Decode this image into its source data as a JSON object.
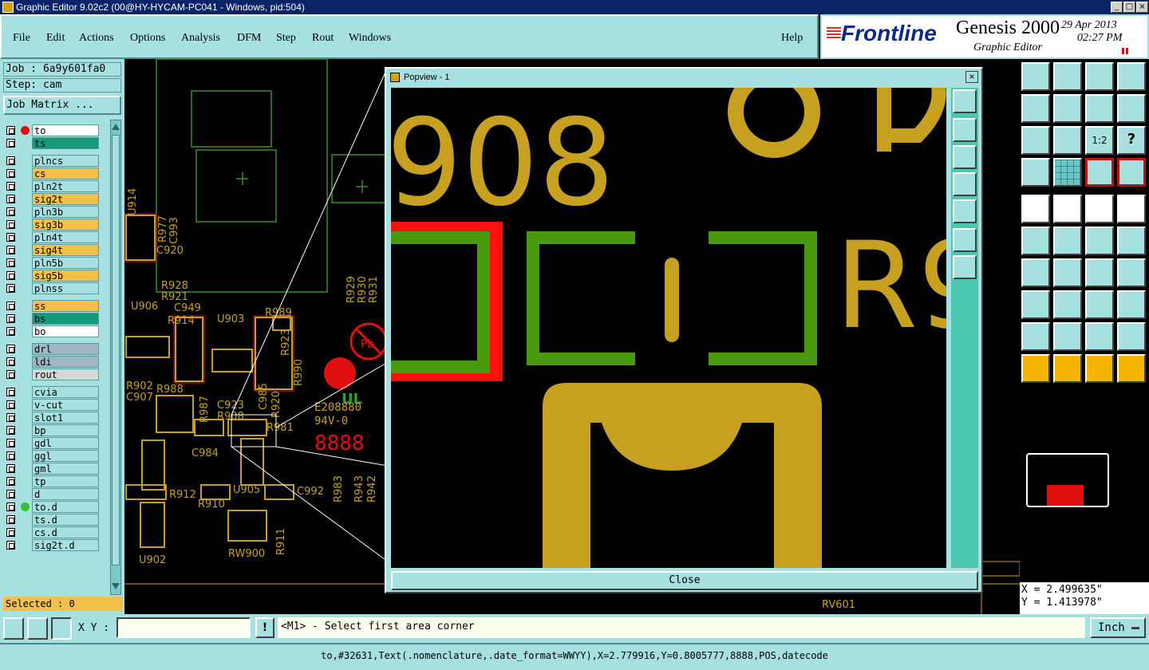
{
  "window": {
    "title": "Graphic Editor 9.02c2 (00@HY-HYCAM-PC041 - Windows, pid:504)"
  },
  "menu": [
    "File",
    "Edit",
    "Actions",
    "Options",
    "Analysis",
    "DFM",
    "Step",
    "Rout",
    "Windows"
  ],
  "help": "Help",
  "brand": {
    "logo": "Frontline",
    "product": "Genesis 2000",
    "subtitle": "Graphic Editor",
    "date": "29 Apr 2013",
    "time": "02:27 PM"
  },
  "job": {
    "job_label": "Job : 6a9y601fa0",
    "step_label": "Step: cam",
    "matrix_button": "Job Matrix ..."
  },
  "layers": [
    {
      "name": "to",
      "color": "#ffffff",
      "dot": "#e01010"
    },
    {
      "name": "ts",
      "color": "#129a7a",
      "dot": ""
    },
    {
      "name": "plncs",
      "color": "#a6e0e0",
      "dot": ""
    },
    {
      "name": "cs",
      "color": "#f4c04a",
      "dot": ""
    },
    {
      "name": "pln2t",
      "color": "#a6e0e0",
      "dot": ""
    },
    {
      "name": "sig2t",
      "color": "#f4c04a",
      "dot": ""
    },
    {
      "name": "pln3b",
      "color": "#a6e0e0",
      "dot": ""
    },
    {
      "name": "sig3b",
      "color": "#f4c04a",
      "dot": ""
    },
    {
      "name": "pln4t",
      "color": "#a6e0e0",
      "dot": ""
    },
    {
      "name": "sig4t",
      "color": "#f4c04a",
      "dot": ""
    },
    {
      "name": "pln5b",
      "color": "#a6e0e0",
      "dot": ""
    },
    {
      "name": "sig5b",
      "color": "#f4c04a",
      "dot": ""
    },
    {
      "name": "plnss",
      "color": "#a6e0e0",
      "dot": ""
    },
    {
      "name": "ss",
      "color": "#f4c04a",
      "dot": ""
    },
    {
      "name": "bs",
      "color": "#129a7a",
      "dot": ""
    },
    {
      "name": "bo",
      "color": "#ffffff",
      "dot": ""
    },
    {
      "name": "drl",
      "color": "#a0b4c4",
      "dot": ""
    },
    {
      "name": "ldi",
      "color": "#a0b4c4",
      "dot": ""
    },
    {
      "name": "rout",
      "color": "#d8d8d8",
      "dot": ""
    },
    {
      "name": "cvia",
      "color": "#a6e0e0",
      "dot": ""
    },
    {
      "name": "v-cut",
      "color": "#a6e0e0",
      "dot": ""
    },
    {
      "name": "slot1",
      "color": "#a6e0e0",
      "dot": ""
    },
    {
      "name": "bp",
      "color": "#a6e0e0",
      "dot": ""
    },
    {
      "name": "gdl",
      "color": "#a6e0e0",
      "dot": ""
    },
    {
      "name": "ggl",
      "color": "#a6e0e0",
      "dot": ""
    },
    {
      "name": "gml",
      "color": "#a6e0e0",
      "dot": ""
    },
    {
      "name": "tp",
      "color": "#a6e0e0",
      "dot": ""
    },
    {
      "name": "d",
      "color": "#a6e0e0",
      "dot": ""
    },
    {
      "name": "to.d",
      "color": "#a6e0e0",
      "dot": "#30c030"
    },
    {
      "name": "ts.d",
      "color": "#a6e0e0",
      "dot": ""
    },
    {
      "name": "cs.d",
      "color": "#a6e0e0",
      "dot": ""
    },
    {
      "name": "sig2t.d",
      "color": "#a6e0e0",
      "dot": ""
    }
  ],
  "selected": "Selected : 0",
  "popview": {
    "title": "Popview - 1",
    "close": "Close",
    "text_908": "908",
    "text_r": "R9"
  },
  "coords": {
    "x": "X = 2.499635\"",
    "y": "Y = 1.413978\""
  },
  "status": {
    "xy_label": "X Y :",
    "xy_value": "",
    "prompt": "<M1> - Select first area corner",
    "units": "Inch"
  },
  "info": "to,#32631,Text(.nomenclature,.date_format=WWYY),X=2.779916,Y=0.8005777,8888,POS,datecode",
  "board_labels": [
    "U914",
    "R977",
    "C993",
    "C920",
    "R928",
    "R921",
    "U906",
    "C949",
    "R914",
    "U903",
    "R989",
    "R923",
    "R990",
    "R929",
    "R930",
    "R931",
    "R920",
    "C985",
    "C923",
    "R988",
    "R987",
    "R908",
    "R981",
    "C907",
    "R902",
    "C984",
    "U905",
    "C992",
    "R912",
    "R910",
    "R983",
    "R943",
    "R942",
    "R911",
    "U902",
    "RW900",
    "RV601",
    "E208880",
    "94V-0",
    "8888"
  ]
}
